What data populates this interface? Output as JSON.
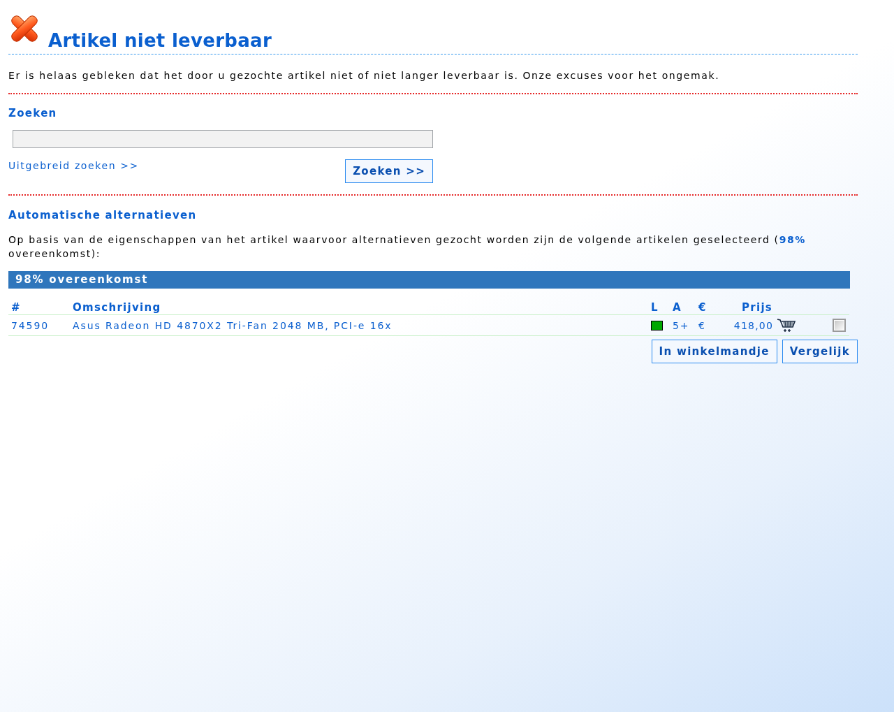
{
  "header": {
    "title": "Artikel niet leverbaar"
  },
  "intro": "Er is helaas gebleken dat het door u gezochte artikel niet of niet langer leverbaar is. Onze excuses voor het ongemak.",
  "search": {
    "heading": "Zoeken",
    "advanced_link": "Uitgebreid zoeken >>",
    "button": "Zoeken >>"
  },
  "alternatives": {
    "heading": "Automatische alternatieven",
    "description": "Op basis van de eigenschappen van het artikel waarvoor alternatieven gezocht worden zijn de volgende artikelen geselecteerd (**98%** overeenkomst):",
    "group_title": "98% overeenkomst",
    "table": {
      "columns": [
        "#",
        "Omschrijving",
        "L",
        "A",
        "€",
        "Prijs"
      ],
      "rows": [
        {
          "number": "74590",
          "description": "Asus Radeon HD 4870X2 Tri-Fan 2048 MB, PCI-e 16x",
          "color": "#00a800",
          "availability": "5+",
          "currency": "€",
          "price": "418,00",
          "checked": false
        }
      ]
    },
    "buttons": [
      "In winkelmandje",
      "Vergelijk"
    ]
  }
}
